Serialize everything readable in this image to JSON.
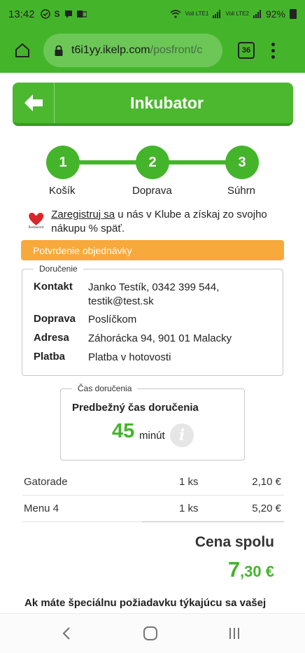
{
  "status_bar": {
    "time": "13:42",
    "notification_icons": [
      "check-circle-icon",
      "s-icon",
      "message-icon",
      "outlook-icon"
    ],
    "signal1": "Voli LTE1",
    "signal2": "Voli LTE2",
    "battery": "92%"
  },
  "browser": {
    "url_host": "t6i1yy.ikelp.com",
    "url_path": "/posfront/c",
    "tab_count": "36"
  },
  "header": {
    "title": "Inkubator"
  },
  "steps": [
    {
      "number": "1",
      "label": "Košík"
    },
    {
      "number": "2",
      "label": "Doprava"
    },
    {
      "number": "3",
      "label": "Súhrn"
    }
  ],
  "promo": {
    "link": "Zaregistruj sa",
    "text": " u nás v Klube a získaj zo svojho nákupu % späť."
  },
  "confirmation": {
    "label": "Potvrdenie objednávky"
  },
  "delivery": {
    "legend": "Doručenie",
    "rows": [
      {
        "key": "Kontakt",
        "value": "Janko Testík, 0342 399 544, testik@test.sk"
      },
      {
        "key": "Doprava",
        "value": "Poslíčkom"
      },
      {
        "key": "Adresa",
        "value": "Záhorácka 94, 901 01 Malacky"
      },
      {
        "key": "Platba",
        "value": "Platba v hotovosti"
      }
    ]
  },
  "delivery_time": {
    "legend": "Čas doručenia",
    "title": "Predbežný čas doručenia",
    "value": "45",
    "unit": "minút"
  },
  "items": [
    {
      "name": "Gatorade",
      "qty": "1 ks",
      "price": "2,10 €"
    },
    {
      "name": "Menu 4",
      "qty": "1 ks",
      "price": "5,20 €"
    }
  ],
  "total": {
    "label": "Cena spolu",
    "whole": "7",
    "decimal": ",30 €"
  },
  "special_request": {
    "text": "Ak máte špeciálnu požiadavku týkajúcu sa vašej"
  },
  "colors": {
    "brand_green": "#44b52b",
    "confirm_orange": "#f8a93c"
  }
}
